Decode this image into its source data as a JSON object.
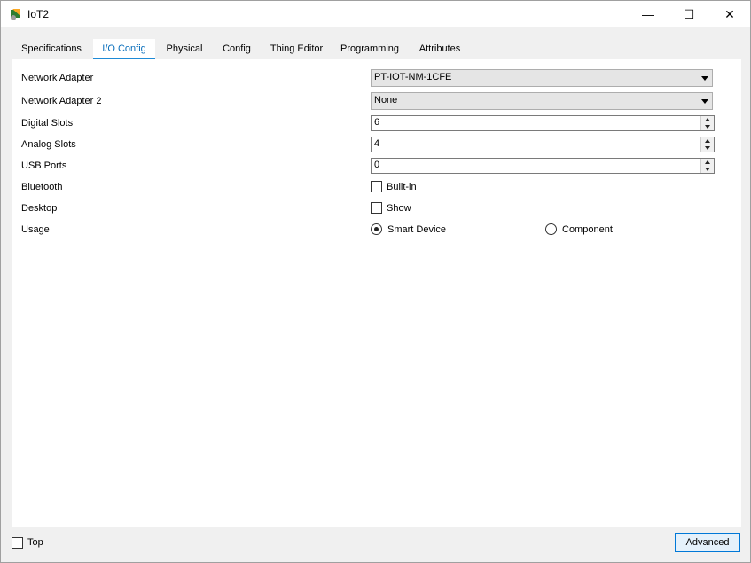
{
  "window": {
    "title": "IoT2",
    "icon": "packet-tracer-iot-icon"
  },
  "window_controls": {
    "minimize": "—",
    "maximize": "☐",
    "close": "✕"
  },
  "tabs": [
    {
      "label": "Specifications",
      "active": false
    },
    {
      "label": "I/O Config",
      "active": true
    },
    {
      "label": "Physical",
      "active": false
    },
    {
      "label": "Config",
      "active": false
    },
    {
      "label": "Thing Editor",
      "active": false
    },
    {
      "label": "Programming",
      "active": false
    },
    {
      "label": "Attributes",
      "active": false
    }
  ],
  "form": {
    "network_adapter": {
      "label": "Network Adapter",
      "value": "PT-IOT-NM-1CFE"
    },
    "network_adapter_2": {
      "label": "Network Adapter 2",
      "value": "None"
    },
    "digital_slots": {
      "label": "Digital Slots",
      "value": "6"
    },
    "analog_slots": {
      "label": "Analog Slots",
      "value": "4"
    },
    "usb_ports": {
      "label": "USB Ports",
      "value": "0"
    },
    "bluetooth": {
      "label": "Bluetooth",
      "option": "Built-in",
      "checked": false
    },
    "desktop": {
      "label": "Desktop",
      "option": "Show",
      "checked": false
    },
    "usage": {
      "label": "Usage",
      "options": [
        "Smart Device",
        "Component"
      ],
      "selected": "Smart Device"
    }
  },
  "footer": {
    "top_label": "Top",
    "top_checked": false,
    "advanced_label": "Advanced"
  },
  "colors": {
    "accent": "#1e8ad6",
    "active_tab_text": "#0a6fbc",
    "button_bg": "#e5f1fb",
    "button_border": "#0078d7"
  }
}
